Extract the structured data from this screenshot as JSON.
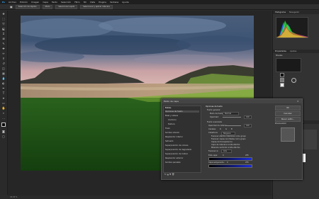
{
  "app": {
    "menu": [
      "Archivo",
      "Edición",
      "Imagen",
      "Capa",
      "Texto",
      "Selección",
      "Filtro",
      "3D",
      "Vista",
      "Plugins",
      "Ventana",
      "Ayuda"
    ],
    "options": {
      "tool_mode": "Selección de objetos",
      "mode_label": "Modo",
      "select_subject": "Seleccionar sujeto",
      "select_refine": "Seleccionar y aplicar máscara"
    },
    "status": "33,33 %"
  },
  "right_panel": {
    "tabs_top": [
      "Histograma",
      "Navegador"
    ],
    "tabs_mid": [
      "Propiedades",
      "Ajustes"
    ],
    "tabs_layers": [
      "Capas",
      "Canales",
      "Trazados"
    ],
    "properties_title": "Niveles",
    "histogram_colors": [
      "#ff2a2a",
      "#2aff2a",
      "#2a6bff",
      "#ffff33"
    ]
  },
  "dialog": {
    "title": "Estilo de capa",
    "styles_header": "Estilos",
    "left_items": [
      "Opciones de fusión",
      "Bisel y relieve",
      "Contorno",
      "Textura",
      "Trazo",
      "Sombra interior",
      "Resplandor interior",
      "Satinado",
      "Superposición de colores",
      "Superposición de degradado",
      "Superposición de motivo",
      "Resplandor exterior",
      "Sombra paralela"
    ],
    "section_title": "Opciones de fusión",
    "general_blend": "Fusión general",
    "blend_mode_label": "Modo de fusión:",
    "blend_mode_value": "Normal",
    "opacity_label": "Opacidad:",
    "opacity_value": "100",
    "advanced_blend": "Fusión avanzada",
    "fill_opacity_label": "Opacidad de relleno:",
    "fill_opacity_value": "100",
    "channels_label": "Canales:",
    "channel_r": "R",
    "channel_g": "G",
    "channel_b": "B",
    "knockout_label": "Cobertura:",
    "knockout_value": "Ninguna",
    "opt1": "Fusionar efectos interiores como grupo",
    "opt2": "Fusionar capas recortadas como grupo",
    "opt3": "Capas de transparencia",
    "opt4": "Capa de máscara oculta efectos",
    "opt5": "Máscara vectorial oculta efectos",
    "blend_if_label": "Fusionar si:",
    "blend_if_value": "Gris",
    "this_layer": "Esta capa:",
    "this_layer_min": "0",
    "this_layer_max": "255",
    "under_layer": "Capa subyacente:",
    "under_layer_min": "0",
    "under_layer_max": "255",
    "ok": "OK",
    "cancel": "Cancelar",
    "new_style": "Nuevo estilo...",
    "preview": "Previsualizar"
  }
}
